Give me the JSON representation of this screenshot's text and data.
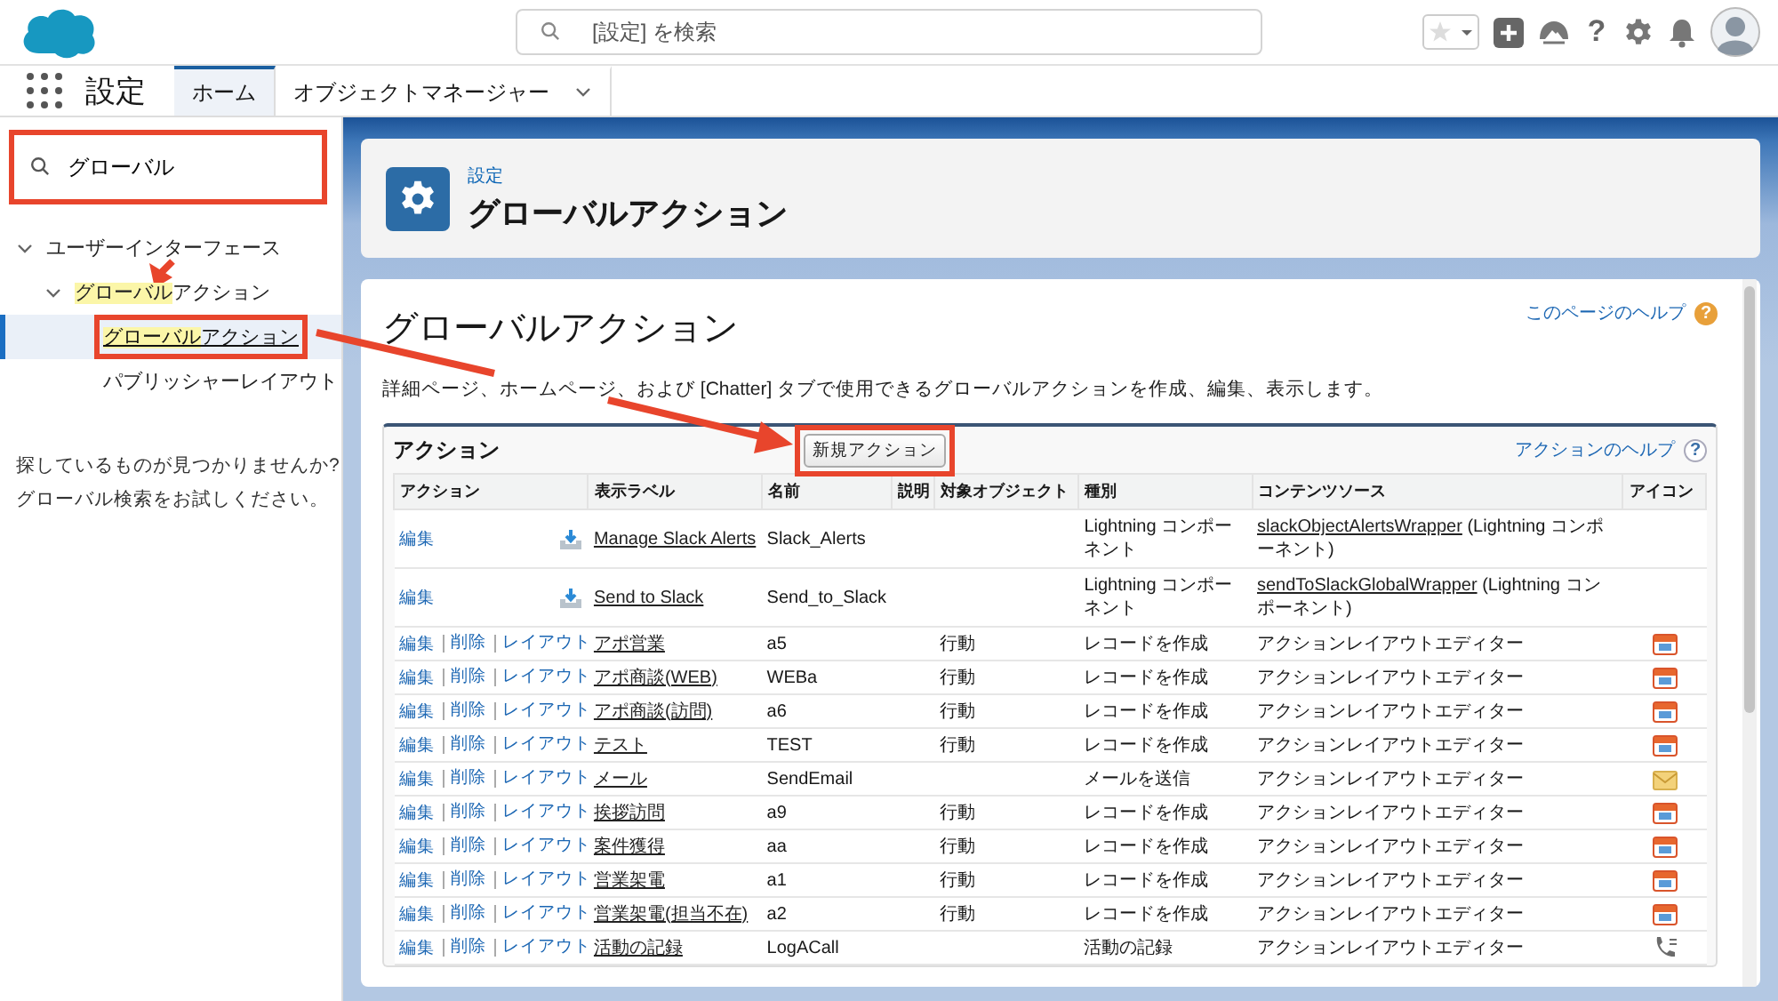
{
  "header": {
    "search": {
      "placeholder": "[設定] を検索"
    },
    "help_glyph": "?"
  },
  "nav": {
    "app_name": "設定",
    "tabs": [
      {
        "label": "ホーム",
        "selected": true,
        "dropdown": false
      },
      {
        "label": "オブジェクトマネージャー",
        "selected": false,
        "dropdown": true
      }
    ]
  },
  "sidebar": {
    "search": {
      "value": "グローバル",
      "highlighted": true
    },
    "tree": [
      {
        "label_parts": [
          {
            "text": "ユーザーインターフェース",
            "match": false
          }
        ],
        "expanded": true,
        "selected": false,
        "highlighted": false,
        "children": [
          {
            "label_parts": [
              {
                "text": "グローバル",
                "match": true
              },
              {
                "text": "アクション",
                "match": false
              }
            ],
            "expanded": true,
            "selected": false,
            "highlighted": false,
            "children": [
              {
                "label_parts": [
                  {
                    "text": "グローバル",
                    "match": true
                  },
                  {
                    "text": "アクション",
                    "match": false
                  }
                ],
                "selected": true,
                "highlighted": true
              },
              {
                "label_parts": [
                  {
                    "text": "パブリッシャーレイアウト",
                    "match": false
                  }
                ],
                "selected": false,
                "highlighted": false
              }
            ]
          }
        ]
      }
    ],
    "help_text": "探しているものが見つかりませんか?\nグローバル検索をお試しください。"
  },
  "page_header": {
    "breadcrumb": "設定",
    "title": "グローバルアクション"
  },
  "content": {
    "title": "グローバルアクション",
    "help_link": {
      "label": "このページのヘルプ",
      "glyph": "?"
    },
    "description": "詳細ページ、ホームページ、および [Chatter] タブで使用できるグローバルアクションを作成、編集、表示します。",
    "section": {
      "title": "アクション",
      "new_button": {
        "label": "新規アクション",
        "highlighted": true
      },
      "help_link": {
        "label": "アクションのヘルプ",
        "glyph": "?"
      },
      "columns": [
        "アクション",
        "表示ラベル",
        "名前",
        "説明",
        "対象オブジェクト",
        "種別",
        "コンテンツソース",
        "アイコン"
      ],
      "rows": [
        {
          "kind": "lightning",
          "actions": [
            "編集"
          ],
          "label": "Manage Slack Alerts",
          "name": "Slack_Alerts",
          "type": "Lightning コンポーネント",
          "source_link": "slackObjectAlertsWrapper",
          "source": "(Lightning コンポーネント)"
        },
        {
          "kind": "lightning",
          "actions": [
            "編集"
          ],
          "label": "Send to Slack",
          "name": "Send_to_Slack",
          "type": "Lightning コンポーネント",
          "source_link": "sendToSlackGlobalWrapper",
          "source": "(Lightning コンポーネント)"
        },
        {
          "kind": "record",
          "actions": [
            "編集",
            "削除",
            "レイアウト"
          ],
          "label": "アポ営業",
          "name": "a5",
          "object": "行動",
          "type": "レコードを作成",
          "source": "アクションレイアウトエディター"
        },
        {
          "kind": "record",
          "actions": [
            "編集",
            "削除",
            "レイアウト"
          ],
          "label": "アポ商談(WEB)",
          "name": "WEBa",
          "object": "行動",
          "type": "レコードを作成",
          "source": "アクションレイアウトエディター"
        },
        {
          "kind": "record",
          "actions": [
            "編集",
            "削除",
            "レイアウト"
          ],
          "label": "アポ商談(訪問)",
          "name": "a6",
          "object": "行動",
          "type": "レコードを作成",
          "source": "アクションレイアウトエディター"
        },
        {
          "kind": "record",
          "actions": [
            "編集",
            "削除",
            "レイアウト"
          ],
          "label": "テスト",
          "name": "TEST",
          "object": "行動",
          "type": "レコードを作成",
          "source": "アクションレイアウトエディター"
        },
        {
          "kind": "mail",
          "actions": [
            "編集",
            "削除",
            "レイアウト"
          ],
          "label": "メール",
          "name": "SendEmail",
          "type": "メールを送信",
          "source": "アクションレイアウトエディター"
        },
        {
          "kind": "record",
          "actions": [
            "編集",
            "削除",
            "レイアウト"
          ],
          "label": "挨拶訪問",
          "name": "a9",
          "object": "行動",
          "type": "レコードを作成",
          "source": "アクションレイアウトエディター"
        },
        {
          "kind": "record",
          "actions": [
            "編集",
            "削除",
            "レイアウト"
          ],
          "label": "案件獲得",
          "name": "aa",
          "object": "行動",
          "type": "レコードを作成",
          "source": "アクションレイアウトエディター"
        },
        {
          "kind": "record",
          "actions": [
            "編集",
            "削除",
            "レイアウト"
          ],
          "label": "営業架電",
          "name": "a1",
          "object": "行動",
          "type": "レコードを作成",
          "source": "アクションレイアウトエディター"
        },
        {
          "kind": "record",
          "actions": [
            "編集",
            "削除",
            "レイアウト"
          ],
          "label": "営業架電(担当不在)",
          "name": "a2",
          "object": "行動",
          "type": "レコードを作成",
          "source": "アクションレイアウトエディター"
        },
        {
          "kind": "call",
          "actions": [
            "編集",
            "削除",
            "レイアウト"
          ],
          "label": "活動の記録",
          "name": "LogACall",
          "type": "活動の記録",
          "source": "アクションレイアウトエディター"
        }
      ]
    }
  }
}
